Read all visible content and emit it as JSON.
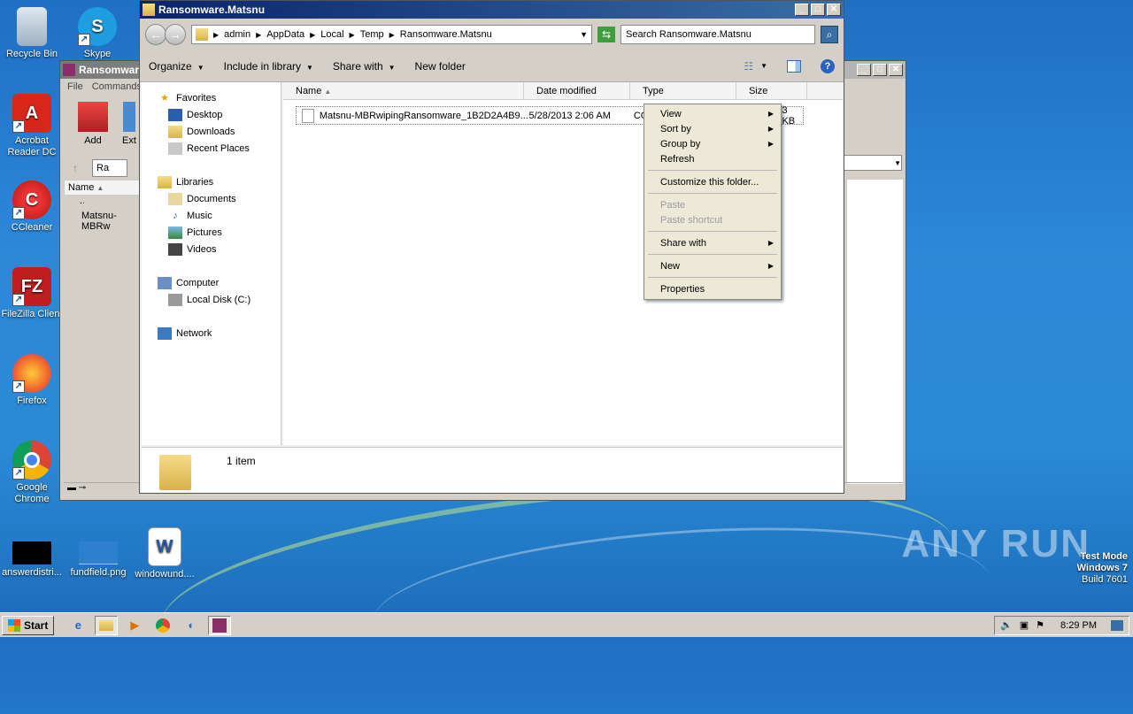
{
  "desktop_icons": [
    {
      "label": "Recycle Bin",
      "icon": "recycle-bin-icon"
    },
    {
      "label": "Skype",
      "icon": "skype-icon"
    },
    {
      "label": "Acrobat Reader DC",
      "icon": "acrobat-icon"
    },
    {
      "label": "CCleaner",
      "icon": "ccleaner-icon"
    },
    {
      "label": "FileZilla Client",
      "icon": "filezilla-icon"
    },
    {
      "label": "Firefox",
      "icon": "firefox-icon"
    },
    {
      "label": "Google Chrome",
      "icon": "chrome-icon"
    },
    {
      "label": "answerdistri...",
      "icon": "image-file-icon"
    },
    {
      "label": "fundfield.png",
      "icon": "image-file-icon"
    },
    {
      "label": "windowund....",
      "icon": "word-doc-icon"
    }
  ],
  "rar": {
    "title": "Ransomware.Matsnu",
    "menu": [
      "File",
      "Commands"
    ],
    "toolbar": [
      "Add",
      "Ext"
    ],
    "path_short": "Ra",
    "col_name": "Name",
    "rows": [
      "..",
      "Matsnu-MBRw"
    ]
  },
  "explorer": {
    "title": "Ransomware.Matsnu",
    "breadcrumb": [
      "admin",
      "AppData",
      "Local",
      "Temp",
      "Ransomware.Matsnu"
    ],
    "search_placeholder": "Search Ransomware.Matsnu",
    "commands": [
      "Organize",
      "Include in library",
      "Share with",
      "New folder"
    ],
    "nav": {
      "favorites": "Favorites",
      "fav_items": [
        "Desktop",
        "Downloads",
        "Recent Places"
      ],
      "libraries": "Libraries",
      "lib_items": [
        "Documents",
        "Music",
        "Pictures",
        "Videos"
      ],
      "computer": "Computer",
      "comp_items": [
        "Local Disk (C:)"
      ],
      "network": "Network"
    },
    "columns": [
      "Name",
      "Date modified",
      "Type",
      "Size"
    ],
    "file": {
      "name": "Matsnu-MBRwipingRansomware_1B2D2A4B9...",
      "date": "5/28/2013 2:06 AM",
      "type": "CO",
      "size": "3 KB"
    },
    "status": "1 item"
  },
  "context_menu": {
    "items": [
      {
        "label": "View",
        "sub": true
      },
      {
        "label": "Sort by",
        "sub": true
      },
      {
        "label": "Group by",
        "sub": true
      },
      {
        "label": "Refresh",
        "sub": false
      },
      {
        "label": "Customize this folder...",
        "sub": false
      },
      {
        "label": "Paste",
        "sub": false,
        "disabled": true
      },
      {
        "label": "Paste shortcut",
        "sub": false,
        "disabled": true
      },
      {
        "label": "Share with",
        "sub": true
      },
      {
        "label": "New",
        "sub": true
      },
      {
        "label": "Properties",
        "sub": false
      }
    ]
  },
  "taskbar": {
    "start": "Start",
    "time": "8:29 PM"
  },
  "watermark": {
    "line1": "Test Mode",
    "line2": "Windows 7",
    "line3": "Build 7601",
    "brand": "ANY RUN"
  }
}
